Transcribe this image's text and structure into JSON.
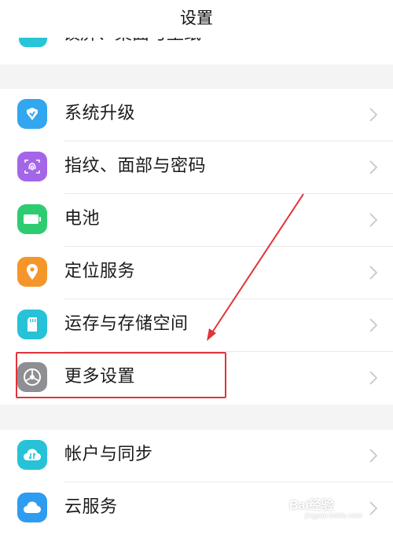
{
  "header": {
    "title": "设置"
  },
  "partial_row": {
    "label": "锁屏、桌面与壁纸",
    "icon": "theme-icon"
  },
  "group1": {
    "items": [
      {
        "label": "系统升级",
        "icon": "system-update-icon",
        "color": "#33a6f0"
      },
      {
        "label": "指纹、面部与密码",
        "icon": "fingerprint-icon",
        "color": "#a466e8"
      },
      {
        "label": "电池",
        "icon": "battery-icon",
        "color": "#2ecc71"
      },
      {
        "label": "定位服务",
        "icon": "location-pin-icon",
        "color": "#f5962b"
      },
      {
        "label": "运存与存储空间",
        "icon": "sd-card-icon",
        "color": "#27c2d8"
      },
      {
        "label": "更多设置",
        "icon": "gear-icon",
        "color": "#8e8e93"
      }
    ]
  },
  "group2": {
    "items": [
      {
        "label": "帐户与同步",
        "icon": "account-sync-icon",
        "color": "#27c2d8"
      },
      {
        "label": "云服务",
        "icon": "cloud-icon",
        "color": "#2e9cf0"
      }
    ]
  },
  "annotation": {
    "highlight_color": "#e2333b",
    "target": "更多设置"
  },
  "watermark": {
    "text": "Bai经验",
    "sub": "jingyan.baidu.com"
  }
}
